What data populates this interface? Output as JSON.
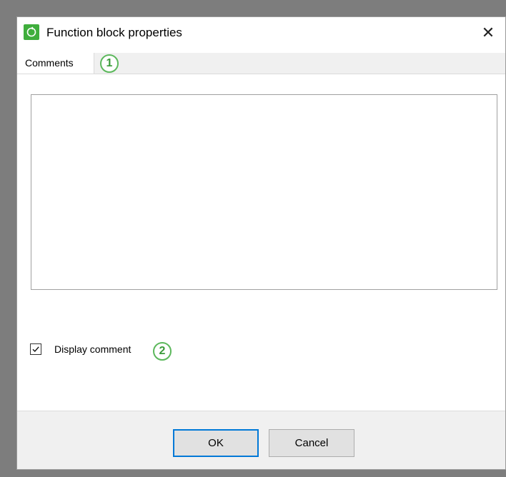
{
  "dialog": {
    "title": "Function block properties",
    "close_glyph": "✕",
    "tabs": [
      {
        "label": "Comments",
        "selected": true
      }
    ],
    "callouts": [
      "1",
      "2"
    ],
    "comment_text": "",
    "display_comment": {
      "label": "Display comment",
      "checked": true
    },
    "buttons": {
      "ok": "OK",
      "cancel": "Cancel"
    }
  },
  "icons": {
    "app": "function-block-app-icon",
    "close": "close-icon",
    "check": "checkmark-icon"
  },
  "colors": {
    "accent": "#0078d7",
    "callout": "#5cb85c",
    "app_icon": "#3fae3c"
  }
}
